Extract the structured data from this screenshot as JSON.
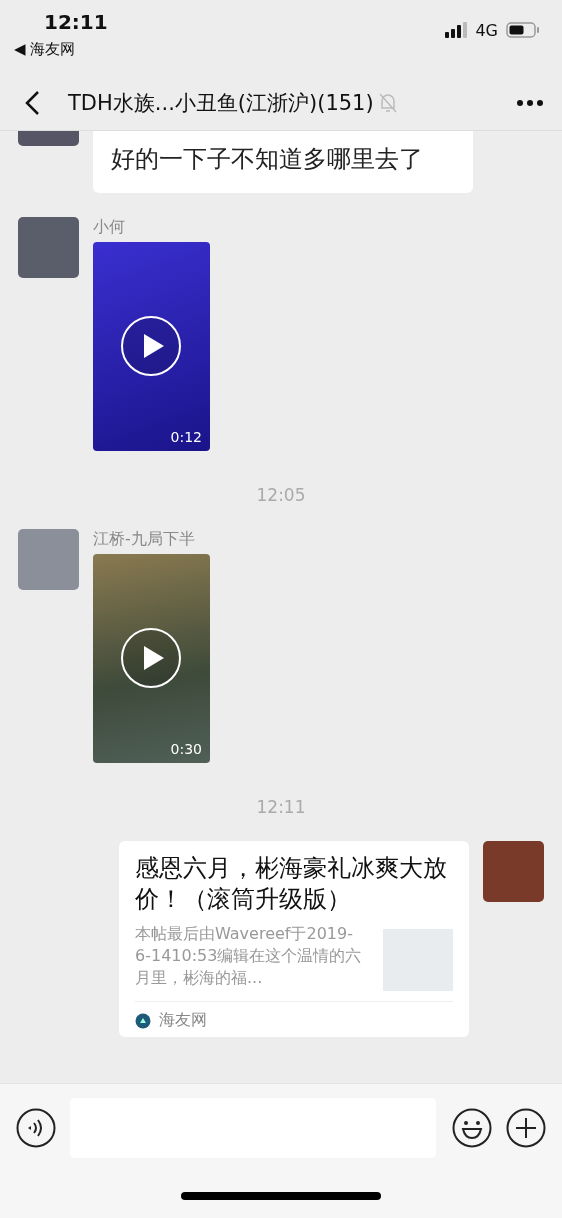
{
  "status_bar": {
    "time": "12:11",
    "back_app": "◀ 海友网",
    "network": "4G"
  },
  "header": {
    "title": "TDH水族...小丑鱼(江浙沪)(151)",
    "muted": true
  },
  "messages": [
    {
      "kind": "text",
      "mine": false,
      "text": "好的一下子不知道多哪里去了"
    },
    {
      "kind": "video",
      "mine": false,
      "sender": "小何",
      "duration": "0:12"
    },
    {
      "kind": "time",
      "text": "12:05"
    },
    {
      "kind": "video",
      "mine": false,
      "sender": "江桥-九局下半",
      "duration": "0:30"
    },
    {
      "kind": "time",
      "text": "12:11"
    },
    {
      "kind": "link",
      "mine": true,
      "title": "感恩六月，彬海豪礼冰爽大放价！（滚筒升级版）",
      "summary": "本帖最后由Wavereef于2019-6-1410:53编辑在这个温情的六月里，彬海的福...",
      "source": "海友网"
    }
  ]
}
